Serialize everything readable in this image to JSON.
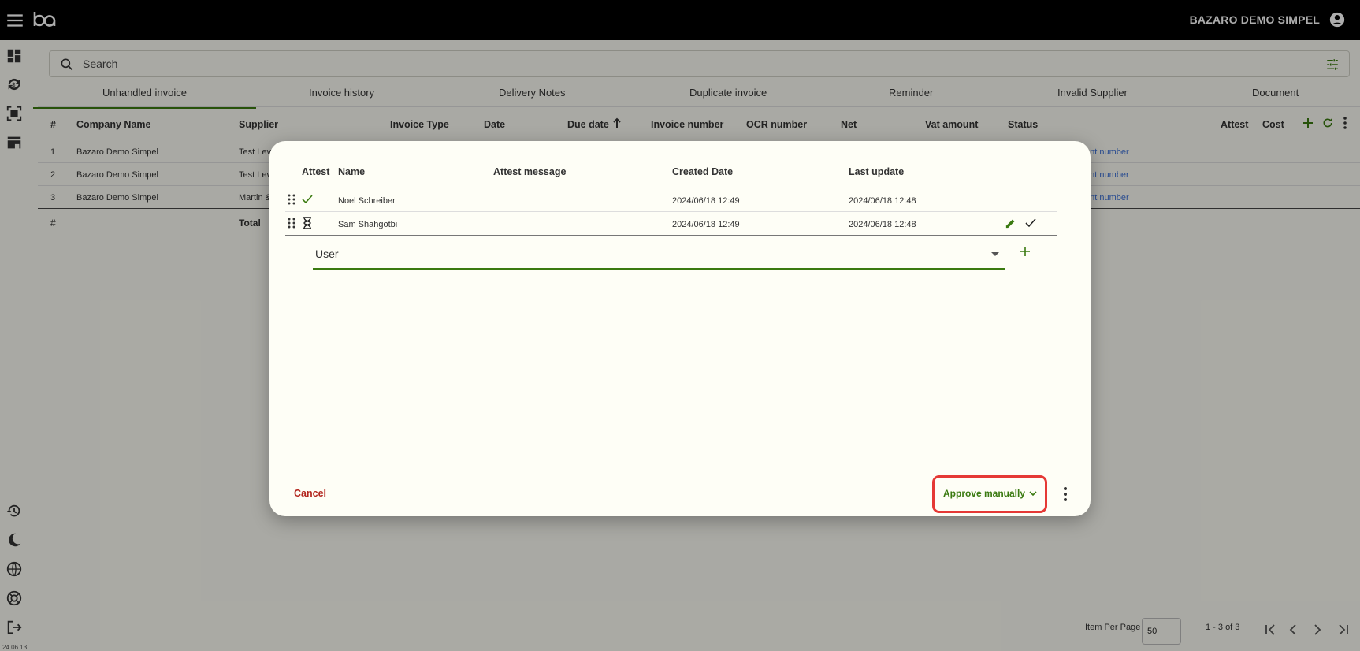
{
  "topbar": {
    "company": "BAZARO DEMO SIMPEL"
  },
  "search": {
    "placeholder": "Search"
  },
  "tabs": [
    "Unhandled invoice",
    "Invoice history",
    "Delivery Notes",
    "Duplicate invoice",
    "Reminder",
    "Invalid Supplier",
    "Document"
  ],
  "grid": {
    "headers": {
      "num": "#",
      "company": "Company Name",
      "supplier": "Supplier",
      "invoice_type": "Invoice Type",
      "date": "Date",
      "due_date": "Due date",
      "invoice_number": "Invoice number",
      "ocr": "OCR number",
      "net": "Net",
      "vat": "Vat amount",
      "status": "Status",
      "attest": "Attest",
      "cost": "Cost"
    },
    "rows": [
      {
        "num": "1",
        "company": "Bazaro Demo Simpel",
        "supplier": "Test Leve",
        "status": "ant number"
      },
      {
        "num": "2",
        "company": "Bazaro Demo Simpel",
        "supplier": "Test Leve",
        "status": "ant number"
      },
      {
        "num": "3",
        "company": "Bazaro Demo Simpel",
        "supplier": "Martin &",
        "status": "ant number"
      }
    ],
    "total_row": {
      "num": "#",
      "label": "Total"
    }
  },
  "footer": {
    "items_per_page_label": "Item Per Page",
    "items_per_page_value": "50",
    "range": "1 - 3 of 3",
    "version": "24.06.13"
  },
  "dialog": {
    "headers": {
      "attest": "Attest",
      "name": "Name",
      "attest_message": "Attest message",
      "created": "Created Date",
      "updated": "Last update"
    },
    "rows": [
      {
        "status": "approved",
        "name": "Noel Schreiber",
        "message": "",
        "created": "2024/06/18 12:49",
        "updated": "2024/06/18 12:48"
      },
      {
        "status": "pending",
        "name": "Sam Shahgotbi",
        "message": "",
        "created": "2024/06/18 12:49",
        "updated": "2024/06/18 12:48"
      }
    ],
    "user_field_label": "User",
    "cancel_label": "Cancel",
    "approve_label": "Approve manually"
  },
  "colors": {
    "accent": "#3a7a10",
    "danger": "#b3261e",
    "highlight": "#e53935"
  }
}
